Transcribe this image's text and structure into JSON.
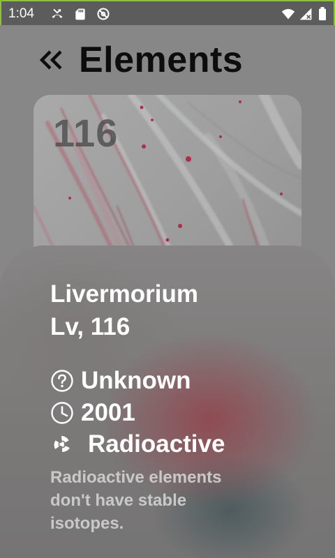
{
  "status_bar": {
    "time": "1:04",
    "icons": [
      "missed-call-icon",
      "sd-card-icon",
      "do-not-disturb-icon",
      "wifi-icon",
      "cellular-icon",
      "battery-icon"
    ]
  },
  "header": {
    "back_icon": "double-chevron-left-icon",
    "title": "Elements"
  },
  "hero": {
    "atomic_number": "116"
  },
  "element": {
    "name": "Livermorium",
    "symbol_number": "Lv, 116",
    "phase": "Unknown",
    "discovered": "2001",
    "type": "Radioactive",
    "description": "Radioactive elements don't have stable isotopes."
  },
  "icons": {
    "phase": "question-circle-icon",
    "year": "clock-icon",
    "type": "radioactive-icon"
  },
  "colors": {
    "background": "#878787",
    "status_bar": "#5c5c5c",
    "title": "#0d0d0d",
    "sheet_text": "#ffffff",
    "description_text": "#c9c9c9",
    "accent_red": "#b01a3a"
  }
}
